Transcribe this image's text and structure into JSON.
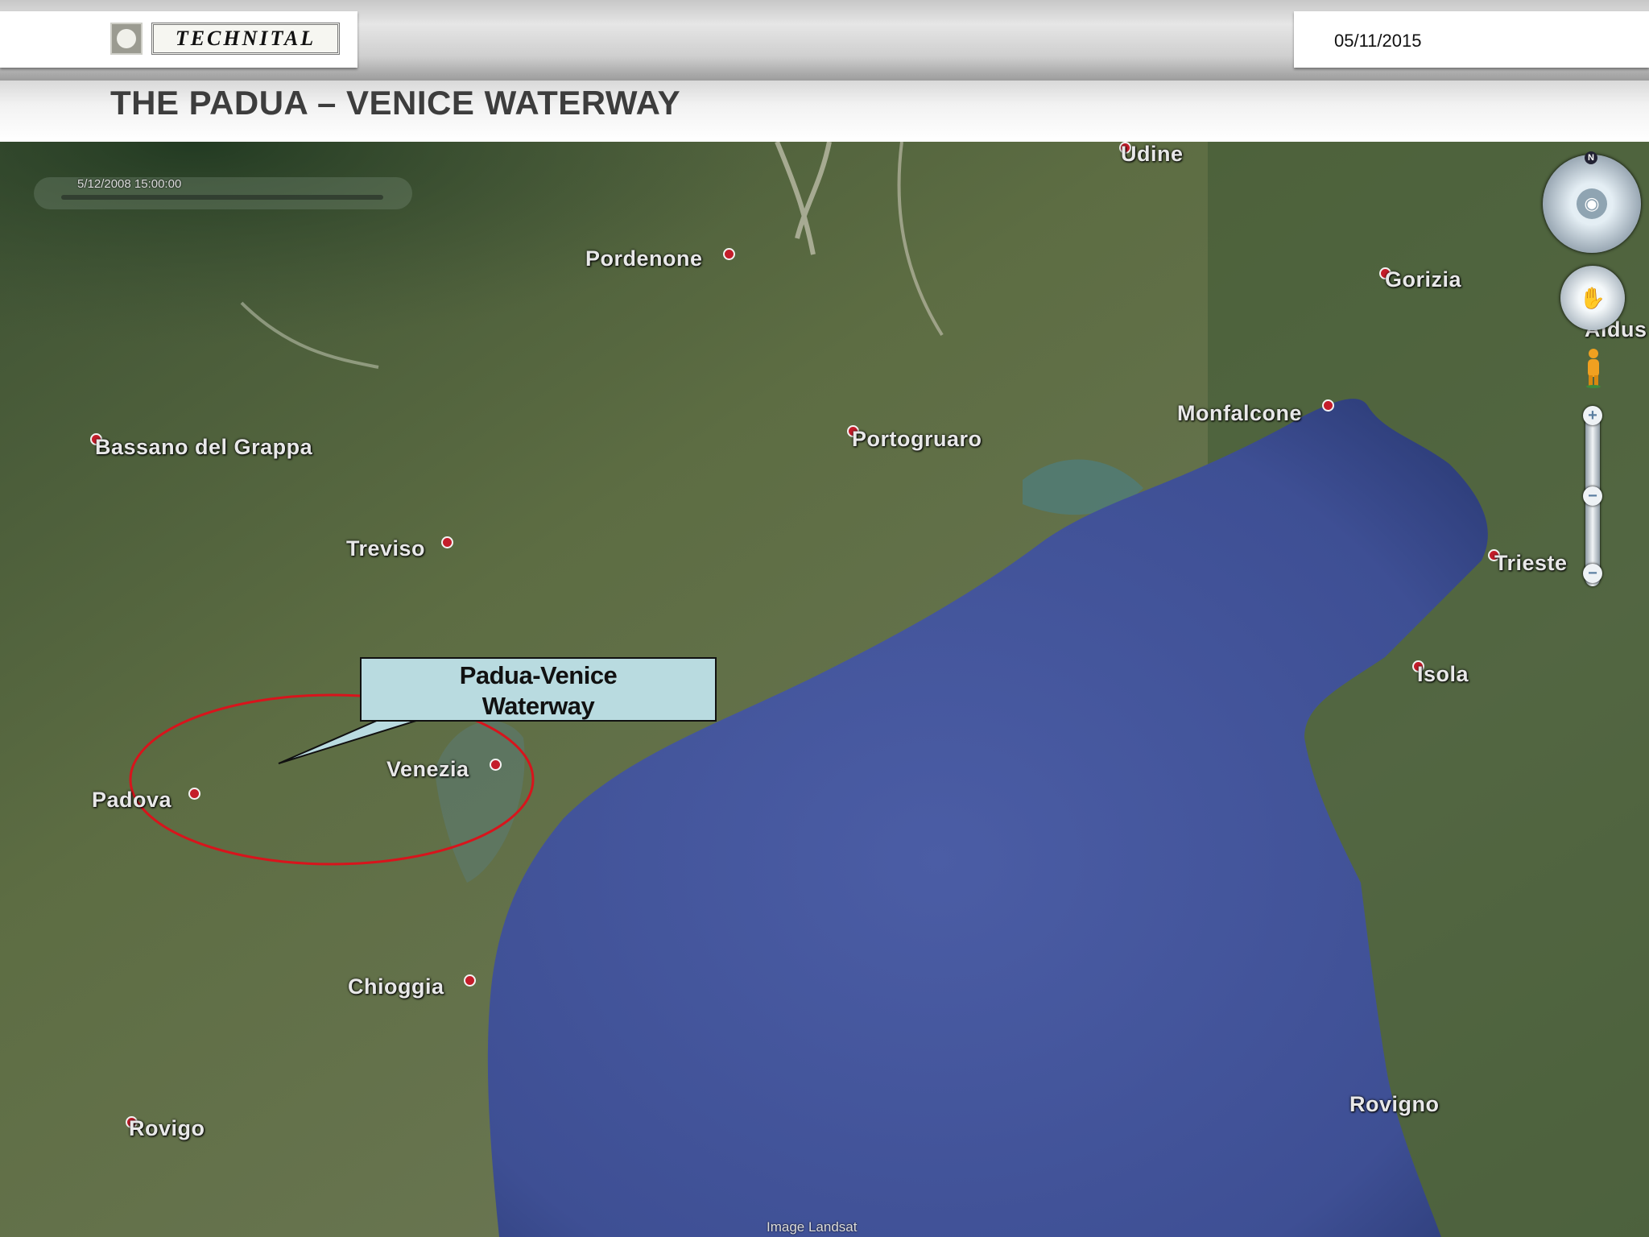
{
  "header": {
    "logo_text": "TECHNITAL",
    "date": "05/11/2015",
    "title": "THE PADUA – VENICE WATERWAY"
  },
  "map": {
    "timestamp": "5/12/2008  15:00:00",
    "places": {
      "udine": "Udine",
      "pordenone": "Pordenone",
      "gorizia": "Gorizia",
      "aidus": "Aidus",
      "bassano": "Bassano del Grappa",
      "portogruaro": "Portogruaro",
      "monfalcone": "Monfalcone",
      "treviso": "Treviso",
      "trieste": "Trieste",
      "isola": "Isola",
      "venezia": "Venezia",
      "padova": "Padova",
      "chioggia": "Chioggia",
      "rovigno": "Rovigno",
      "rovigo": "Rovigo"
    },
    "callout": {
      "line1": "Padua-Venice",
      "line2": "Waterway"
    },
    "credit": "Image Landsat",
    "controls": {
      "north": "N",
      "zoom_in": "+",
      "zoom_mid": "−",
      "zoom_out": "−"
    }
  },
  "colors": {
    "sea": "#44559a",
    "land": "#55663f",
    "callout_fill": "#b9dbe0",
    "ellipse": "#d8141c",
    "pin": "#c41d2a"
  }
}
